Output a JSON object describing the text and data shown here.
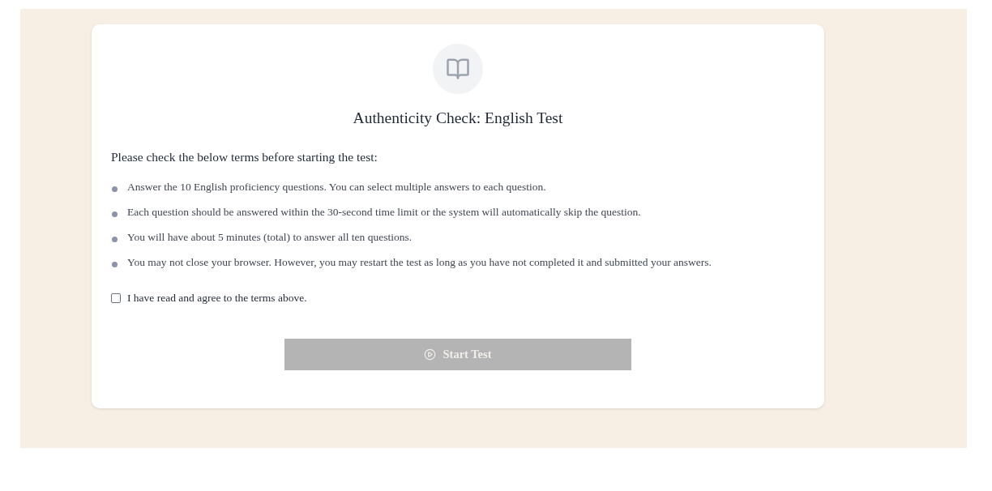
{
  "title": "Authenticity Check: English Test",
  "intro": "Please check the below terms before starting the test:",
  "terms": [
    "Answer the 10 English proficiency questions. You can select multiple answers to each question.",
    "Each question should be answered within the 30-second time limit or the system will automatically skip the question.",
    "You will have about 5 minutes (total) to answer all ten questions.",
    "You may not close your browser. However, you may restart the test as long as you have not completed it and submitted your answers."
  ],
  "agreement": {
    "label": "I have read and agree to the terms above.",
    "checked": false
  },
  "start_button": {
    "label": "Start Test",
    "disabled": true
  }
}
